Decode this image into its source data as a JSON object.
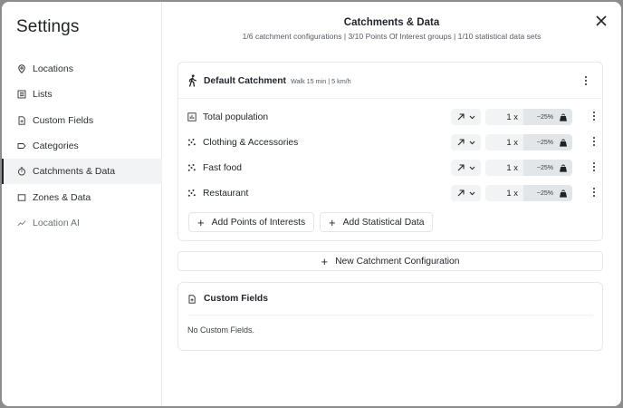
{
  "sidebar": {
    "title": "Settings",
    "items": [
      {
        "label": "Locations",
        "icon": "map-pin-icon"
      },
      {
        "label": "Lists",
        "icon": "list-icon"
      },
      {
        "label": "Custom Fields",
        "icon": "document-plus-icon"
      },
      {
        "label": "Categories",
        "icon": "tag-icon"
      },
      {
        "label": "Catchments & Data",
        "icon": "timer-icon",
        "active": true
      },
      {
        "label": "Zones & Data",
        "icon": "square-icon"
      },
      {
        "label": "Location AI",
        "icon": "trend-line-icon"
      }
    ]
  },
  "header": {
    "title": "Catchments & Data",
    "subtitle": "1/6 catchment configurations | 3/10 Points Of Interest groups | 1/10 statistical data sets"
  },
  "catchment": {
    "name": "Default Catchment",
    "meta": "Walk 15 min | 5 km/h",
    "rows": [
      {
        "label": "Total population",
        "icon": "bar-chart-box-icon",
        "multiplier": "1 x",
        "percent": "~25%"
      },
      {
        "label": "Clothing & Accessories",
        "icon": "scatter-dots-icon",
        "multiplier": "1 x",
        "percent": "~25%"
      },
      {
        "label": "Fast food",
        "icon": "scatter-dots-icon",
        "multiplier": "1 x",
        "percent": "~25%"
      },
      {
        "label": "Restaurant",
        "icon": "scatter-dots-icon",
        "multiplier": "1 x",
        "percent": "~25%"
      }
    ],
    "add_poi_label": "Add Points of Interests",
    "add_stat_label": "Add Statistical Data"
  },
  "new_config_label": "New Catchment Configuration",
  "custom_fields": {
    "title": "Custom Fields",
    "empty": "No Custom Fields."
  }
}
